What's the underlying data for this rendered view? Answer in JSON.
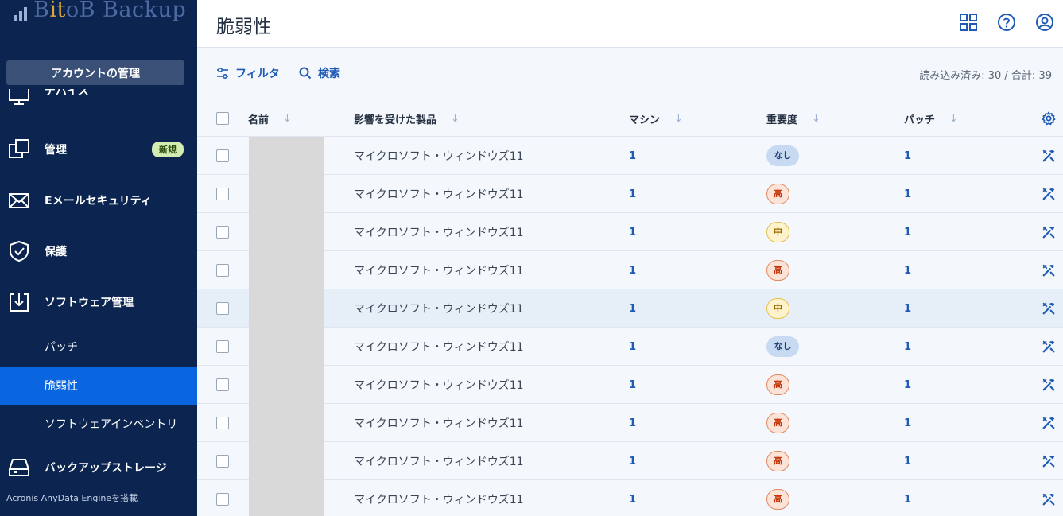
{
  "app": {
    "logo_text_pre": "B",
    "logo_text_i": "it",
    "logo_text_post": "oB Backup",
    "account_button": "アカウントの管理",
    "powered_by": "Acronis AnyData Engineを搭載"
  },
  "sidebar": {
    "items": [
      {
        "label": "デバイス",
        "icon": "monitor-icon"
      },
      {
        "label": "管理",
        "icon": "copy-icon",
        "badge": "新規"
      },
      {
        "label": "Eメールセキュリティ",
        "icon": "envelope-icon"
      },
      {
        "label": "保護",
        "icon": "shield-icon"
      },
      {
        "label": "ソフトウェア管理",
        "icon": "download-tray-icon"
      },
      {
        "label": "バックアップストレージ",
        "icon": "disk-icon"
      }
    ],
    "sub_items": [
      {
        "label": "パッチ"
      },
      {
        "label": "脆弱性",
        "active": true
      },
      {
        "label": "ソフトウェアインベントリ"
      }
    ]
  },
  "header": {
    "title": "脆弱性",
    "icons": [
      "grid-icon",
      "help-icon",
      "account-icon"
    ]
  },
  "toolbar": {
    "filter_label": "フィルタ",
    "search_label": "検索",
    "counter": "読み込み済み: 30 / 合計: 39"
  },
  "table": {
    "columns": {
      "name": "名前",
      "product": "影響を受けた製品",
      "machines": "マシン",
      "severity": "重要度",
      "patches": "パッチ"
    },
    "rows": [
      {
        "product": "マイクロソフト・ウィンドウズ11",
        "machines": "1",
        "severity": "なし",
        "sev_class": "none",
        "patches": "1"
      },
      {
        "product": "マイクロソフト・ウィンドウズ11",
        "machines": "1",
        "severity": "高",
        "sev_class": "high",
        "patches": "1"
      },
      {
        "product": "マイクロソフト・ウィンドウズ11",
        "machines": "1",
        "severity": "中",
        "sev_class": "mid",
        "patches": "1"
      },
      {
        "product": "マイクロソフト・ウィンドウズ11",
        "machines": "1",
        "severity": "高",
        "sev_class": "high",
        "patches": "1"
      },
      {
        "product": "マイクロソフト・ウィンドウズ11",
        "machines": "1",
        "severity": "中",
        "sev_class": "mid",
        "patches": "1"
      },
      {
        "product": "マイクロソフト・ウィンドウズ11",
        "machines": "1",
        "severity": "なし",
        "sev_class": "none",
        "patches": "1"
      },
      {
        "product": "マイクロソフト・ウィンドウズ11",
        "machines": "1",
        "severity": "高",
        "sev_class": "high",
        "patches": "1"
      },
      {
        "product": "マイクロソフト・ウィンドウズ11",
        "machines": "1",
        "severity": "高",
        "sev_class": "high",
        "patches": "1"
      },
      {
        "product": "マイクロソフト・ウィンドウズ11",
        "machines": "1",
        "severity": "高",
        "sev_class": "high",
        "patches": "1"
      },
      {
        "product": "マイクロソフト・ウィンドウズ11",
        "machines": "1",
        "severity": "高",
        "sev_class": "high",
        "patches": "1"
      }
    ]
  },
  "colors": {
    "sidebar_bg": "#0c2550",
    "active_item": "#0a66e0",
    "link_blue": "#1f5bb5"
  }
}
